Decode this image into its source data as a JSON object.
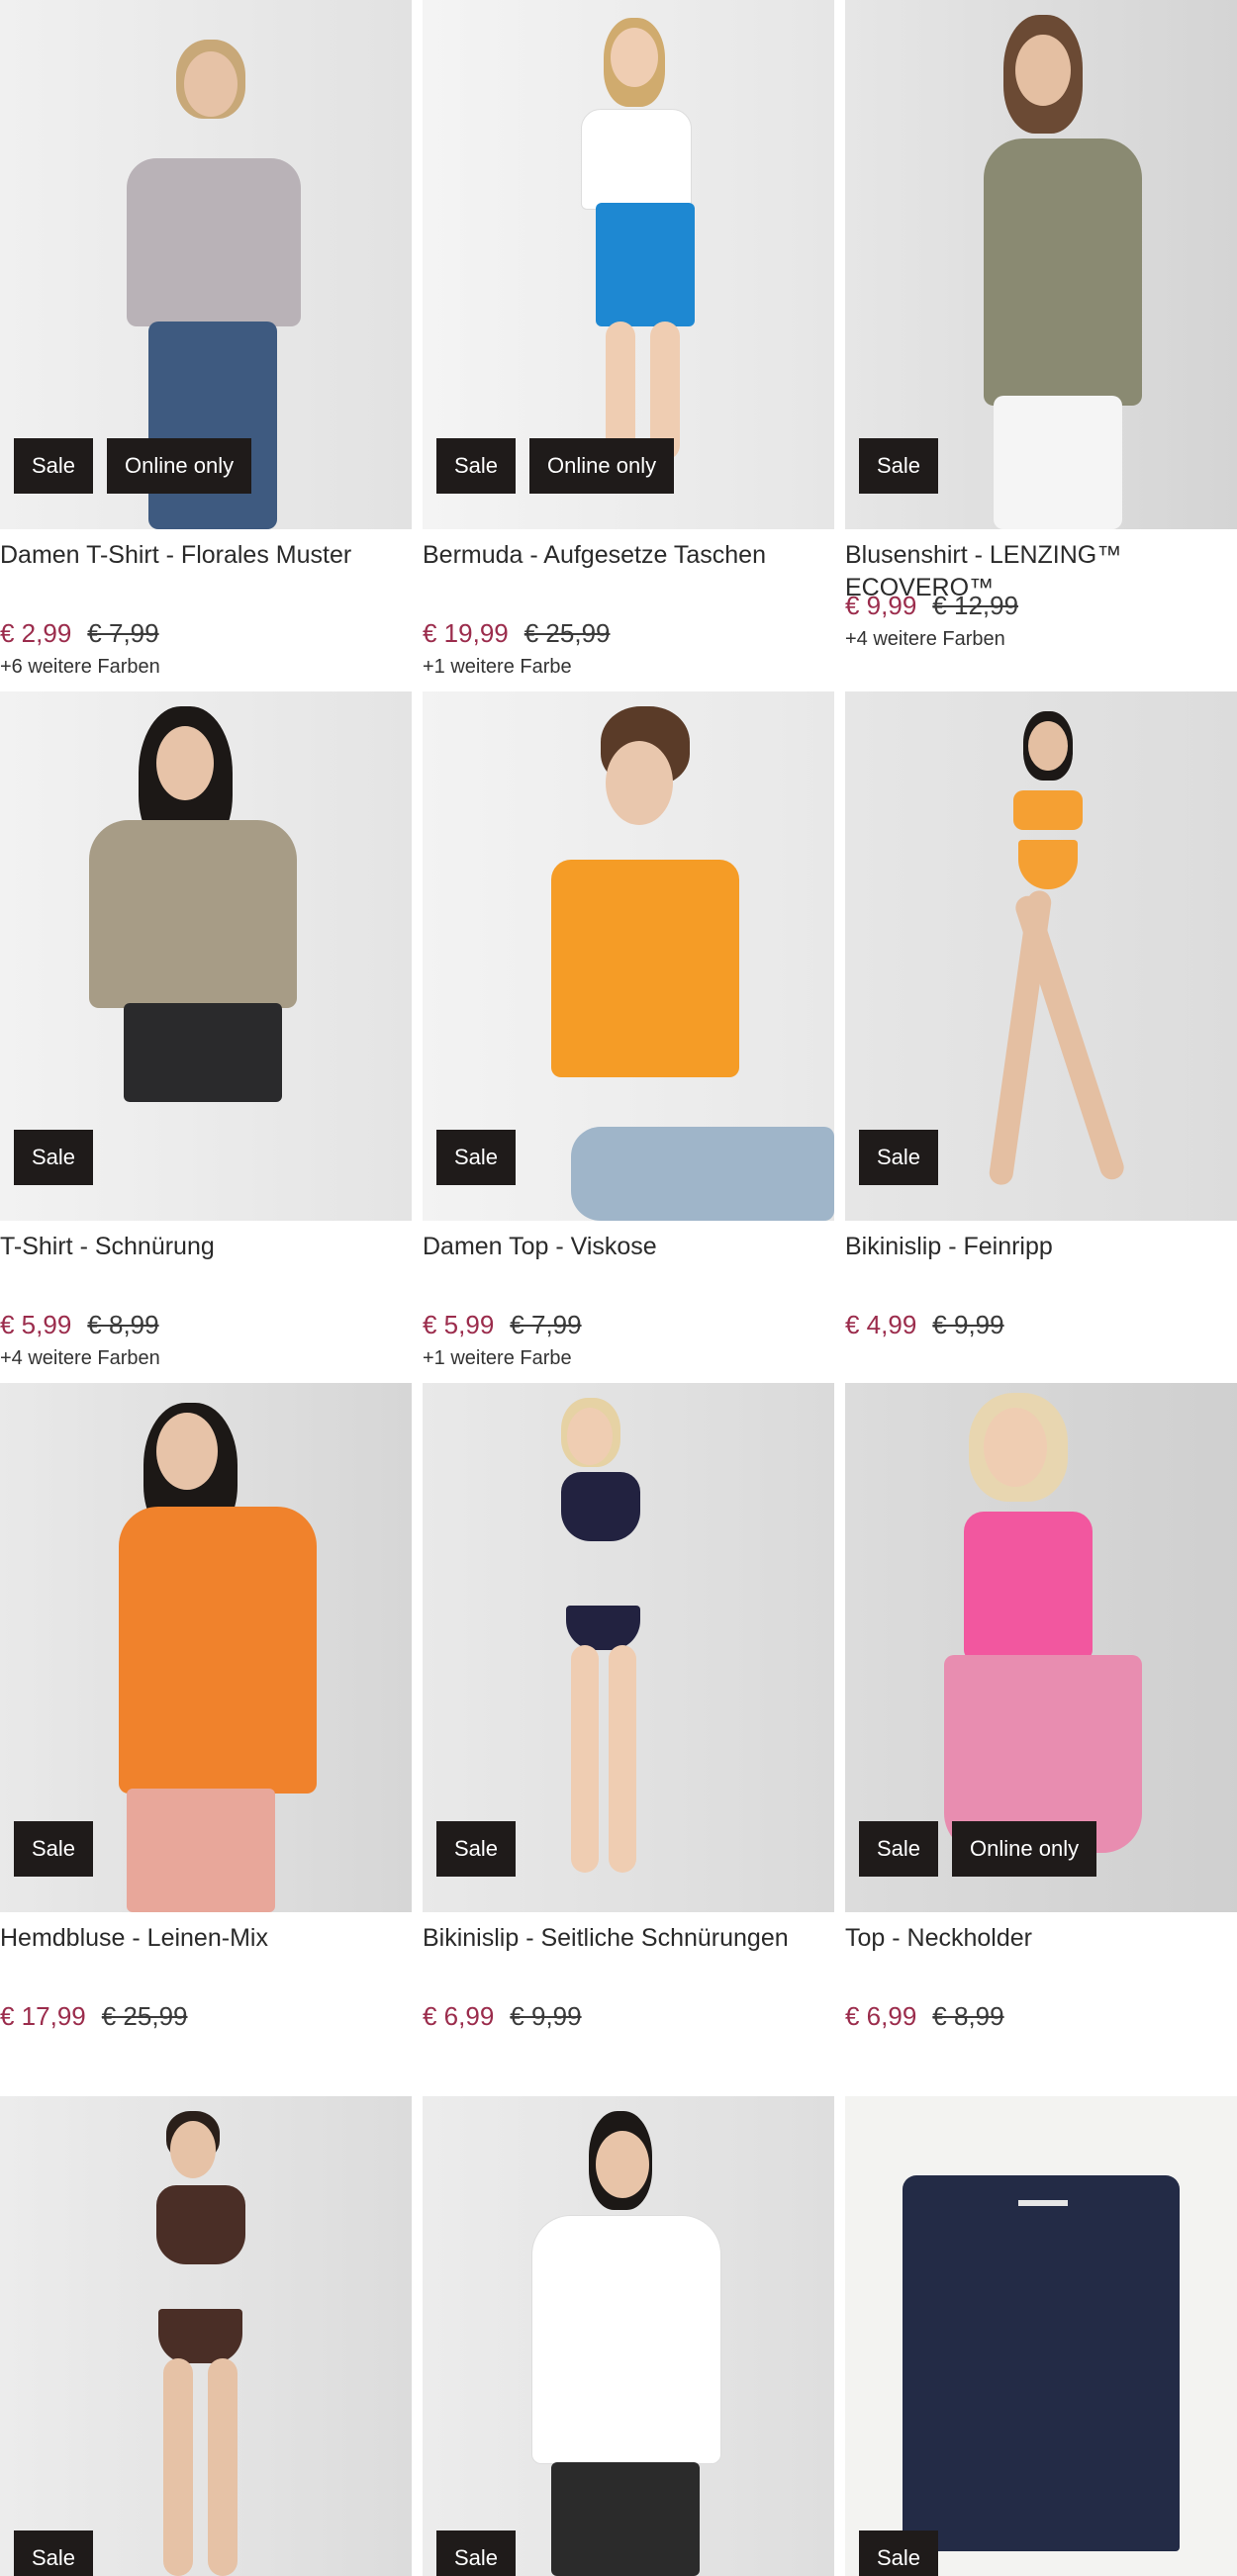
{
  "badges": {
    "sale": "Sale",
    "online": "Online only"
  },
  "products": [
    {
      "title": "Damen T-Shirt - Florales Muster",
      "price": "€ 2,99",
      "old_price": "€ 7,99",
      "colors": "+6 weitere Farben",
      "online_only": true
    },
    {
      "title": "Bermuda - Aufgesetze Taschen",
      "price": "€ 19,99",
      "old_price": "€ 25,99",
      "colors": "+1 weitere Farbe",
      "online_only": true
    },
    {
      "title": "Blusenshirt - LENZING™ ECOVERO™",
      "price": "€ 9,99",
      "old_price": "€ 12,99",
      "colors": "+4 weitere Farben",
      "online_only": false
    },
    {
      "title": "T-Shirt - Schnürung",
      "price": "€ 5,99",
      "old_price": "€ 8,99",
      "colors": "+4 weitere Farben",
      "online_only": false
    },
    {
      "title": "Damen Top - Viskose",
      "price": "€ 5,99",
      "old_price": "€ 7,99",
      "colors": "+1 weitere Farbe",
      "online_only": false
    },
    {
      "title": "Bikinislip - Feinripp",
      "price": "€ 4,99",
      "old_price": "€ 9,99",
      "colors": "",
      "online_only": false
    },
    {
      "title": "Hemdbluse - Leinen-Mix",
      "price": "€ 17,99",
      "old_price": "€ 25,99",
      "colors": "",
      "online_only": false
    },
    {
      "title": "Bikinislip - Seitliche Schnürungen",
      "price": "€ 6,99",
      "old_price": "€ 9,99",
      "colors": "",
      "online_only": false
    },
    {
      "title": "Top - Neckholder",
      "price": "€ 6,99",
      "old_price": "€ 8,99",
      "colors": "",
      "online_only": true
    },
    {
      "title": "",
      "price": "",
      "old_price": "",
      "colors": "",
      "online_only": false
    },
    {
      "title": "",
      "price": "",
      "old_price": "",
      "colors": "",
      "online_only": false
    },
    {
      "title": "",
      "price": "",
      "old_price": "",
      "colors": "",
      "online_only": false
    }
  ],
  "colors": {
    "sale_price": "#9b2c4c",
    "badge_bg": "#1f1b1a"
  }
}
